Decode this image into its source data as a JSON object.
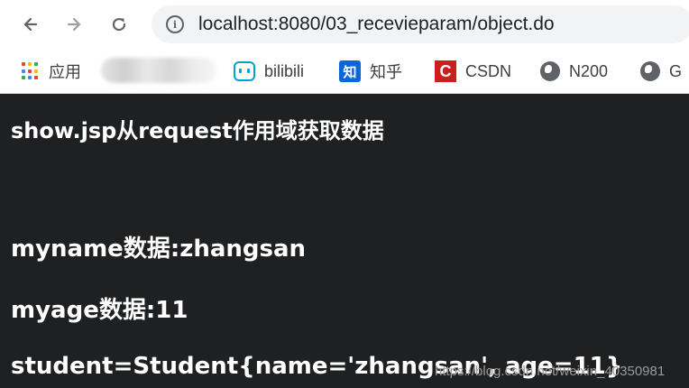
{
  "address_bar": {
    "url": "localhost:8080/03_recevieparam/object.do"
  },
  "bookmarks": [
    {
      "label": "应用",
      "icon": "apps-grid-icon"
    },
    {
      "label": "bilibili",
      "icon": "bilibili-icon"
    },
    {
      "label": "知乎",
      "icon": "zhihu-icon",
      "icon_text": "知"
    },
    {
      "label": "CSDN",
      "icon": "csdn-icon",
      "icon_text": "C"
    },
    {
      "label": "N200",
      "icon": "globe-icon"
    },
    {
      "label": "G",
      "icon": "globe-icon"
    }
  ],
  "page": {
    "heading": "show.jsp从request作用域获取数据",
    "lines": [
      "myname数据:zhangsan",
      "myage数据:11",
      "student=Student{name='zhangsan', age=11}"
    ]
  },
  "watermark": "https://blog.csdn.net/weixin_40350981",
  "colors": {
    "page_bg": "#1f2022",
    "text": "#ffffff",
    "toolbar_bg": "#ffffff",
    "omnibox_bg": "#f1f3f4",
    "bilibili": "#00a1d6",
    "zhihu": "#0a66d9",
    "csdn": "#c91f1f"
  }
}
